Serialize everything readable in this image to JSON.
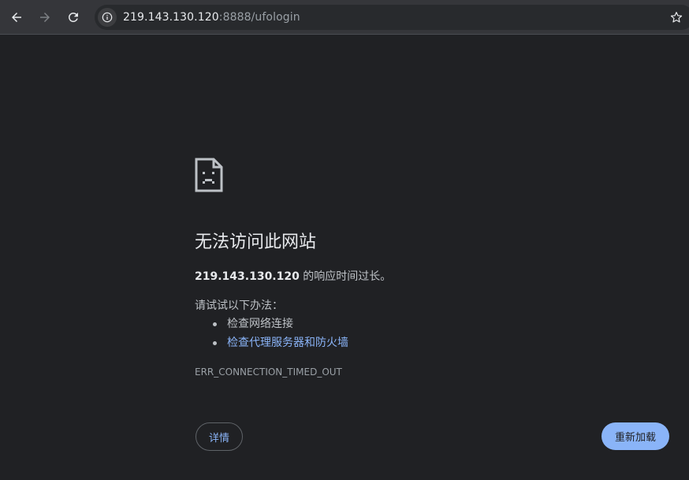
{
  "browser": {
    "url_host": "219.143.130.120",
    "url_rest": ":8888/ufologin",
    "icons": {
      "back": "arrow-left-icon",
      "forward": "arrow-right-icon",
      "reload": "reload-icon",
      "site_info": "info-icon",
      "bookmark": "star-icon"
    }
  },
  "error_page": {
    "icon": "sad-page-icon",
    "title": "无法访问此网站",
    "host": "219.143.130.120",
    "description_suffix": " 的响应时间过长。",
    "suggestions_heading": "请试试以下办法：",
    "suggestions": [
      {
        "text": "检查网络连接",
        "link": false
      },
      {
        "text": "检查代理服务器和防火墙",
        "link": true
      }
    ],
    "error_code": "ERR_CONNECTION_TIMED_OUT",
    "details_label": "详情",
    "reload_label": "重新加载"
  },
  "colors": {
    "background": "#202124",
    "toolbar": "#35363a",
    "link": "#8ab4f8",
    "primary_button": "#8ab4f8"
  }
}
